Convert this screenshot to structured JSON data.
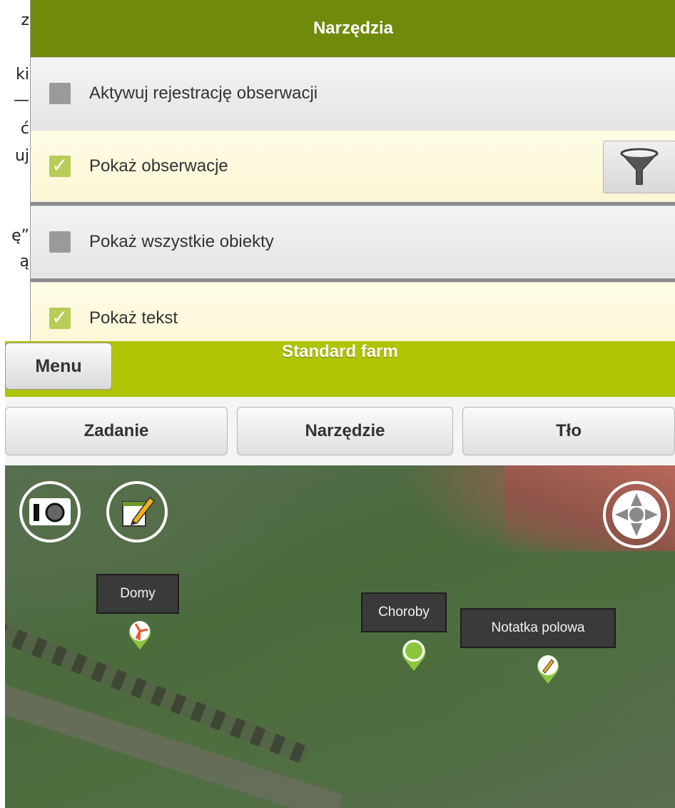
{
  "side_text": [
    "z",
    "ki",
    "—",
    "ć",
    "uj",
    "ę”",
    "ą"
  ],
  "tools_panel": {
    "title": "Narzędzia",
    "rows": [
      {
        "label": "Aktywuj rejestrację obserwacji",
        "checked": false
      },
      {
        "label": "Pokaż obserwacje",
        "checked": true
      },
      {
        "label": "Pokaż wszystkie obiekty",
        "checked": false
      },
      {
        "label": "Pokaż tekst",
        "checked": true
      }
    ]
  },
  "app": {
    "title": "Standard farm",
    "menu_label": "Menu",
    "tabs": [
      "Zadanie",
      "Narzędzie",
      "Tło"
    ]
  },
  "map": {
    "markers": [
      {
        "label": "Domy",
        "icon": "windmill-icon"
      },
      {
        "label": "Choroby",
        "icon": "leaf-icon"
      },
      {
        "label": "Notatka polowa",
        "icon": "pencil-icon"
      }
    ],
    "buttons": [
      "camera-icon",
      "note-edit-icon",
      "gps-locate-icon"
    ]
  },
  "colors": {
    "tools_header": "#708a0c",
    "appbar": "#afc404",
    "marker_green": "#8cc63f"
  }
}
